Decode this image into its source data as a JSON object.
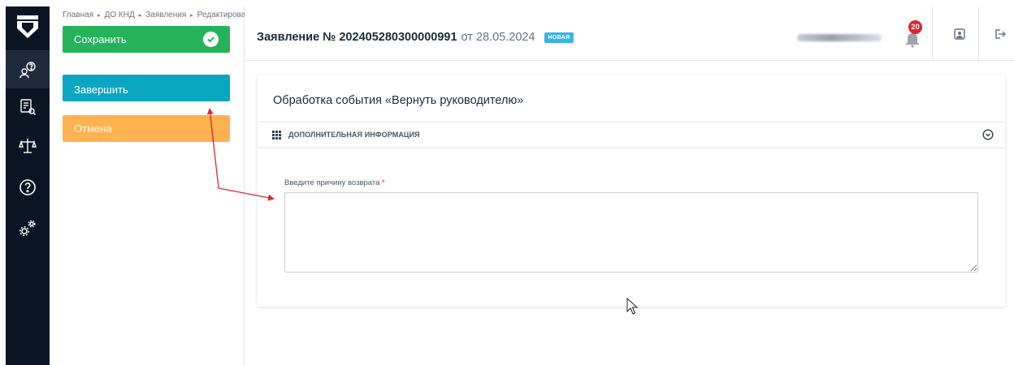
{
  "breadcrumb": {
    "items": [
      "Главная",
      "ДО КНД",
      "Заявления",
      "Редактирование"
    ],
    "separator": "▸"
  },
  "actions": {
    "save_label": "Сохранить",
    "finish_label": "Завершить",
    "cancel_label": "Отмена"
  },
  "header": {
    "doc_title": "Заявление № 202405280300000991",
    "doc_date": "от 28.05.2024",
    "status_badge": "НОВАЯ",
    "notifications_count": "20"
  },
  "card": {
    "title": "Обработка события «Вернуть руководителю»",
    "section_label": "ДОПОЛНИТЕЛЬНАЯ ИНФОРМАЦИЯ",
    "field_label": "Введите причину возврата",
    "required_mark": "*",
    "field_value": ""
  },
  "nav": {
    "icons": [
      "logo-icon",
      "user-help-icon",
      "document-search-icon",
      "scales-icon",
      "help-circle-icon",
      "settings-gears-icon"
    ]
  },
  "colors": {
    "nav_bg": "#0a1424",
    "save": "#24b35a",
    "finish": "#0aa5bf",
    "cancel": "#ffb24f",
    "badge": "#3ab3e8",
    "notification": "#d9262b",
    "annotation_arrow": "#e0282e"
  }
}
